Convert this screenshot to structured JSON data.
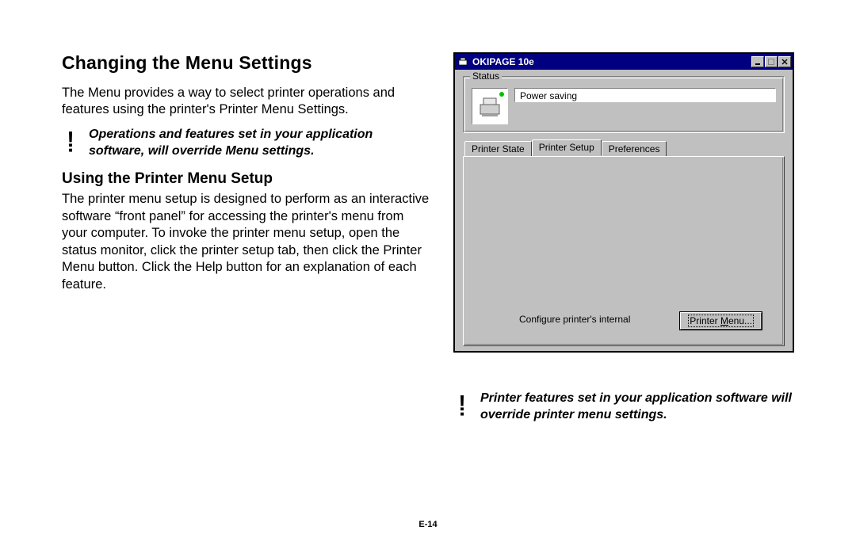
{
  "title": "Changing the Menu Settings",
  "intro": "The Menu provides a way to select printer operations and features using the printer's Printer Menu Settings.",
  "callout1": "Operations and features set in your application software, will override Menu settings.",
  "sub_heading": "Using the Printer Menu Setup",
  "body2": "The printer menu setup is designed to perform as an interactive software “front panel” for accessing the printer's menu from your computer.  To invoke the printer menu setup, open the status monitor, click the printer setup tab, then click the Printer Menu button. Click the Help button for an explanation of each feature.",
  "callout2": "Printer features set in your application software will override printer menu settings.",
  "page_number": "E-14",
  "window": {
    "title": "OKIPAGE 10e",
    "status_label": "Status",
    "status_value": "Power saving",
    "tabs": {
      "printer_state": "Printer State",
      "printer_setup": "Printer Setup",
      "preferences": "Preferences"
    },
    "configure_text": "Configure printer's internal",
    "pm_button_prefix": "Printer ",
    "pm_button_hotkey": "M",
    "pm_button_suffix": "enu..."
  }
}
